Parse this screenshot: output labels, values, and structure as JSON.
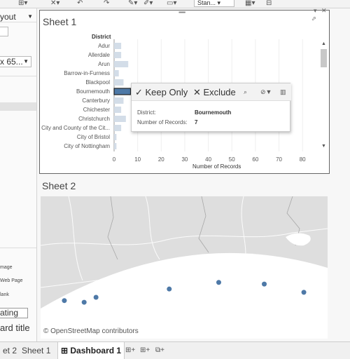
{
  "colors": {
    "bar": "#d3dde8",
    "bar_selected": "#4e79a7",
    "point": "#4e79a7",
    "map_land": "#dedede",
    "map_sea": "#ffffff"
  },
  "toolbar": {
    "icons": [
      "add-sheet-icon",
      "clear-icon",
      "undo-icon",
      "redo-icon",
      "highlight-icon",
      "pen-icon",
      "format-icon",
      "fit-icon",
      "presentation-icon"
    ],
    "fit_select": "Stan..."
  },
  "left_panel": {
    "layout_label": "yout",
    "size_select": "x 65...",
    "objects": [
      "mage",
      "Web Page",
      "lank"
    ],
    "floating_button": "ating",
    "title_label": "ard title"
  },
  "sheet1": {
    "title": "Sheet 1",
    "chart_data": {
      "type": "bar",
      "orientation": "horizontal",
      "row_header": "District",
      "categories": [
        "Adur",
        "Allerdale",
        "Arun",
        "Barrow-in-Furness",
        "Blackpool",
        "Bournemouth",
        "Canterbury",
        "Chichester",
        "Christchurch",
        "City and County of the Cit...",
        "City of Bristol",
        "City of Nottingham"
      ],
      "values": [
        3,
        3,
        6,
        2,
        4,
        7,
        4,
        3,
        5,
        3,
        1,
        1
      ],
      "selected": "Bournemouth",
      "xlabel": "Number of Records",
      "xlim": [
        0,
        85
      ],
      "ticks": [
        0,
        10,
        20,
        30,
        40,
        50,
        60,
        70,
        80
      ],
      "grid": true
    },
    "tooltip": {
      "keep_only": "✓ Keep Only",
      "exclude": "✕ Exclude",
      "icons": [
        "paperclip-icon",
        "group-icon",
        "view-data-icon"
      ],
      "fields": [
        {
          "label": "District:",
          "value": "Bournemouth"
        },
        {
          "label": "Number of Records:",
          "value": "7"
        }
      ]
    }
  },
  "sheet2": {
    "title": "Sheet 2",
    "attribution": "© OpenStreetMap contributors",
    "points": [
      {
        "lon": -1.88,
        "lat": 50.735
      },
      {
        "lon": -1.78,
        "lat": 50.73
      },
      {
        "lon": -1.72,
        "lat": 50.745
      },
      {
        "lon": -1.35,
        "lat": 50.77
      },
      {
        "lon": -1.1,
        "lat": 50.79
      },
      {
        "lon": -0.87,
        "lat": 50.785
      },
      {
        "lon": -0.67,
        "lat": 50.76
      }
    ],
    "lon_range": [
      -2.0,
      -0.55
    ],
    "lat_range": [
      50.62,
      51.05
    ]
  },
  "tabs": {
    "items": [
      {
        "label": "et 2",
        "active": false
      },
      {
        "label": "Sheet 1",
        "active": false
      },
      {
        "label": "⊞ Dashboard 1",
        "active": true
      }
    ],
    "icons": [
      "new-worksheet-icon",
      "new-dashboard-icon",
      "new-story-icon"
    ]
  }
}
